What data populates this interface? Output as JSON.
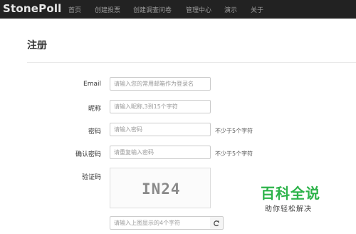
{
  "navbar": {
    "brand": "StonePoll",
    "items": [
      {
        "label": "首页"
      },
      {
        "label": "创建投票"
      },
      {
        "label": "创建调查问卷"
      },
      {
        "label": "管理中心"
      },
      {
        "label": "演示"
      },
      {
        "label": "关于"
      }
    ]
  },
  "page": {
    "title": "注册"
  },
  "form": {
    "email": {
      "label": "Email",
      "placeholder": "请输入您的常用邮箱作为登录名"
    },
    "nickname": {
      "label": "昵称",
      "placeholder": "请输入昵称,3到15个字符"
    },
    "password": {
      "label": "密码",
      "placeholder": "请输入密码",
      "hint": "不少于5个字符"
    },
    "confirm": {
      "label": "确认密码",
      "placeholder": "请重复输入密码",
      "hint": "不少于5个字符"
    },
    "captcha": {
      "label": "验证码",
      "image_text": "IN24",
      "placeholder": "请输入上图显示的4个字符",
      "refresh_icon": "refresh-icon"
    }
  },
  "watermark": {
    "title": "百科全说",
    "subtitle": "助你轻松解决"
  }
}
